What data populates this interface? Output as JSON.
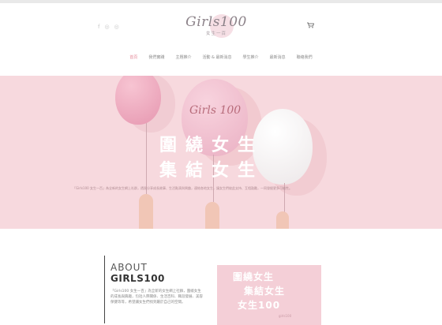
{
  "header": {
    "social": [
      "f",
      "◎",
      "◎"
    ],
    "logo": {
      "text": "Girls100",
      "sub": "女生一百"
    },
    "cart_icon": "cart-icon",
    "nav": [
      {
        "label": "首頁",
        "active": true
      },
      {
        "label": "我們實踐"
      },
      {
        "label": "主題推介"
      },
      {
        "label": "活動 & 最新消息"
      },
      {
        "label": "學生推介"
      },
      {
        "label": "最新消息"
      },
      {
        "label": "聯絡我們"
      }
    ]
  },
  "hero": {
    "brand_script": "Girls 100",
    "title_line1": "圍繞女生",
    "title_line2": "集結女生",
    "description": "「Girls100 女生一百」為全新的女生網上社群，透過分享成長故事、生活點滴與興趣，連結各地女生，讓女生們彼此支持、互相鼓勵，一同發掘更多可能性。"
  },
  "about": {
    "heading1": "ABOUT",
    "heading2": "GIRLS100",
    "paragraph": "「Girls100 女生一百」為全新的女生網上社群，圍繞女生的成長與興趣，包括人際關係、生活百科、職涯發展、美容保健等等，希望讓女生們找到屬於自己的空間。",
    "card_lines": [
      "圍繞女生",
      "集結女生",
      "女生100"
    ],
    "card_small": "girls100"
  },
  "colors": {
    "hero_bg": "#f7d9de",
    "accent": "#e58a9a"
  }
}
